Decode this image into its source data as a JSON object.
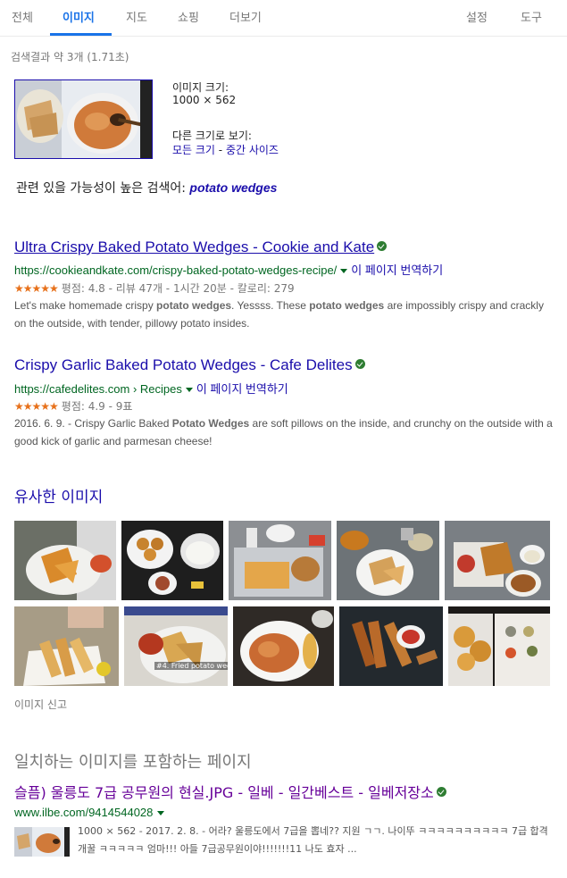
{
  "nav": {
    "tabs": [
      "전체",
      "이미지",
      "지도",
      "쇼핑",
      "더보기"
    ],
    "settings": "설정",
    "tools": "도구"
  },
  "result_stats": "검색결과 약 3개 (1.71초)",
  "query_image": {
    "size_label": "이미지 크기:",
    "size_value": "1000 × 562",
    "other_sizes_label": "다른 크기로 보기:",
    "all_sizes": "모든 크기",
    "separator": " - ",
    "medium_size": "중간 사이즈"
  },
  "related": {
    "prefix": "관련 있을 가능성이 높은 검색어: ",
    "term": "potato wedges"
  },
  "results": [
    {
      "title": "Ultra Crispy Baked Potato Wedges - Cookie and Kate",
      "url": "https://cookieandkate.com/crispy-baked-potato-wedges-recipe/",
      "translate": "이 페이지 번역하기",
      "stars": "★★★★★",
      "rating": "평점: 4.8 - 리뷰 47개 - 1시간 20분 - 칼로리: 279",
      "snippet_parts": [
        "Let's make homemade crispy ",
        "potato wedges",
        ". Yessss. These ",
        "potato wedges",
        " are impossibly crispy and crackly on the outside, with tender, pillowy potato insides."
      ]
    },
    {
      "title": "Crispy Garlic Baked Potato Wedges - Cafe Delites",
      "url": "https://cafedelites.com › Recipes",
      "translate": "이 페이지 번역하기",
      "stars": "★★★★★",
      "rating": "평점: 4.9 - 9표",
      "snippet_parts": [
        "2016. 6. 9. - Crispy Garlic Baked ",
        "Potato Wedges",
        " are soft pillows on the inside, and crunchy on the outside with a good kick of garlic and parmesan cheese!"
      ]
    }
  ],
  "similar_images": {
    "heading": "유사한 이미지",
    "overlay_label": "#4. Fried potato wed",
    "report": "이미지 신고"
  },
  "matching_pages": {
    "heading": "일치하는 이미지를 포함하는 페이지",
    "title": "슬픔) 울릉도 7급 공무원의 현실.JPG - 일베 - 일간베스트 - 일베저장소",
    "url": "www.ilbe.com/9414544028",
    "snippet": "1000 × 562 - 2017. 2. 8. - 어라? 울릉도에서 7급을 뽑네?? 지원 ㄱㄱ. 나이뚜 ㅋㅋㅋㅋㅋㅋㅋㅋㅋㅋ 7급 합격 개꿀 ㅋㅋㅋㅋㅋ 엄마!!! 아들 7급공무원이야!!!!!!!11 나도 효자 ..."
  },
  "colors": {
    "link": "#1a0dab",
    "visited": "#660099",
    "url_green": "#006621",
    "active_tab": "#1a73e8",
    "star": "#e7711b"
  }
}
